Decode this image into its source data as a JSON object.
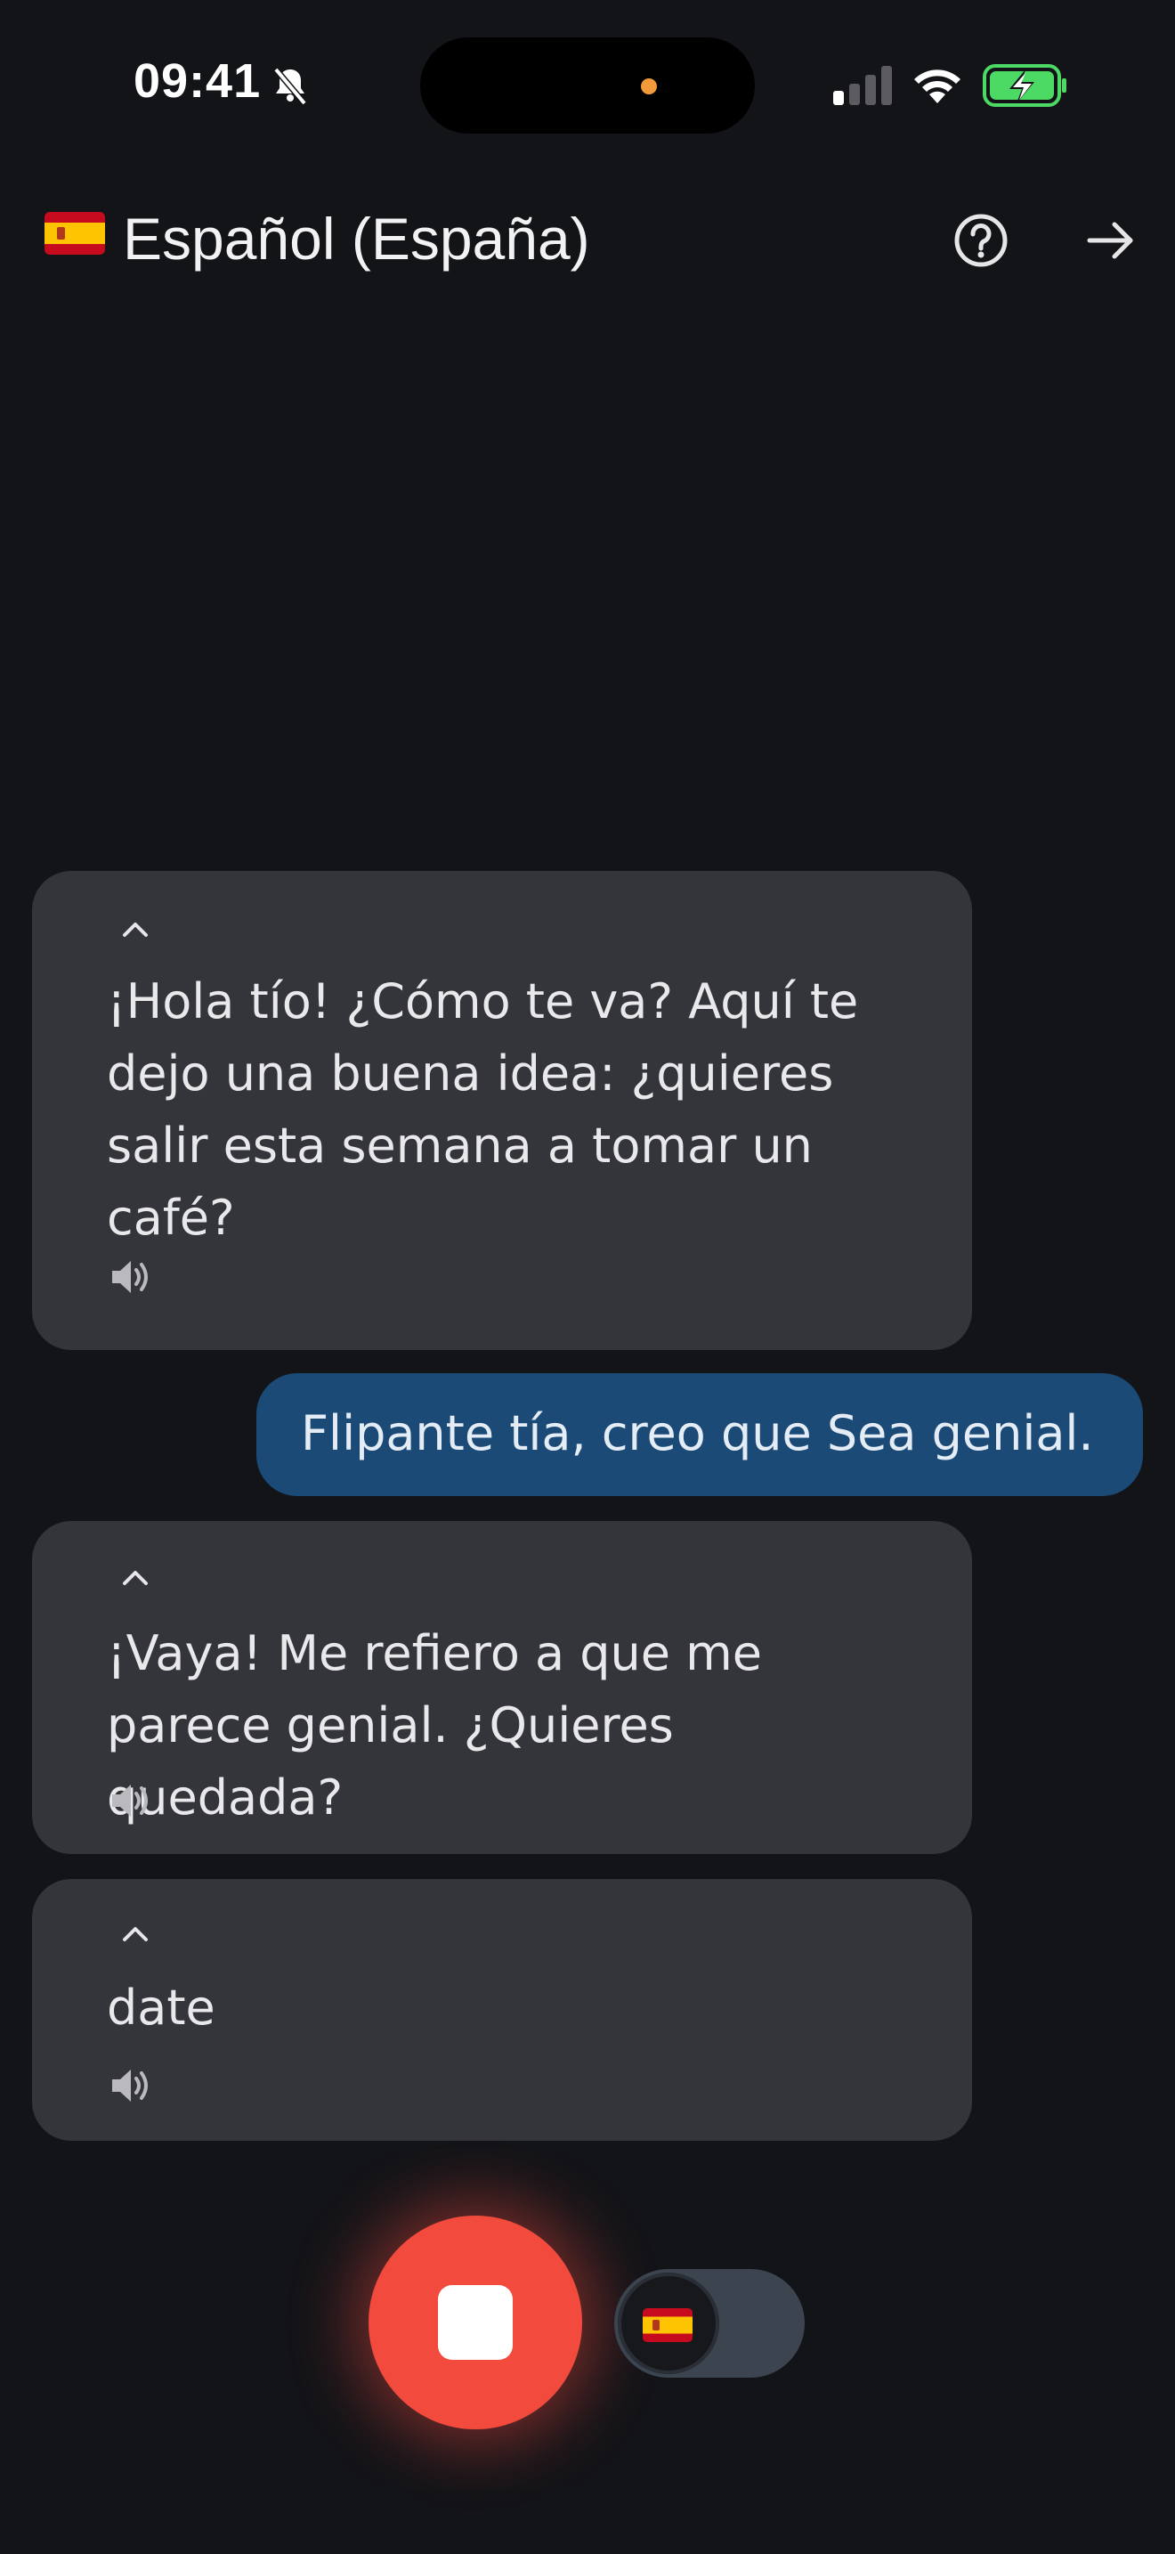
{
  "status_bar": {
    "time": "09:41",
    "icons": [
      "bell-slash-icon",
      "signal-icon",
      "wifi-icon",
      "battery-charging-icon"
    ]
  },
  "header": {
    "flag": "spain-flag-icon",
    "title": "Español (España)",
    "help_icon": "help-circle-icon",
    "next_icon": "arrow-right-icon"
  },
  "messages": [
    {
      "role": "assistant",
      "text": "¡Hola tío! ¿Cómo te va? Aquí te dejo una buena idea: ¿quieres salir esta semana a tomar un café?"
    },
    {
      "role": "user",
      "text": "Flipante tía, creo que Sea genial."
    },
    {
      "role": "assistant",
      "text": "¡Vaya! Me refiero a que me parece genial. ¿Quieres quedada?"
    },
    {
      "role": "assistant",
      "text": "date"
    }
  ],
  "controls": {
    "record_state": "recording",
    "toggle_flag": "spain-flag-icon"
  },
  "colors": {
    "background": "#131418",
    "assistant_bubble": "#34353a",
    "user_bubble": "#1b4a77",
    "record": "#f24a3d",
    "battery": "#4cd964"
  }
}
